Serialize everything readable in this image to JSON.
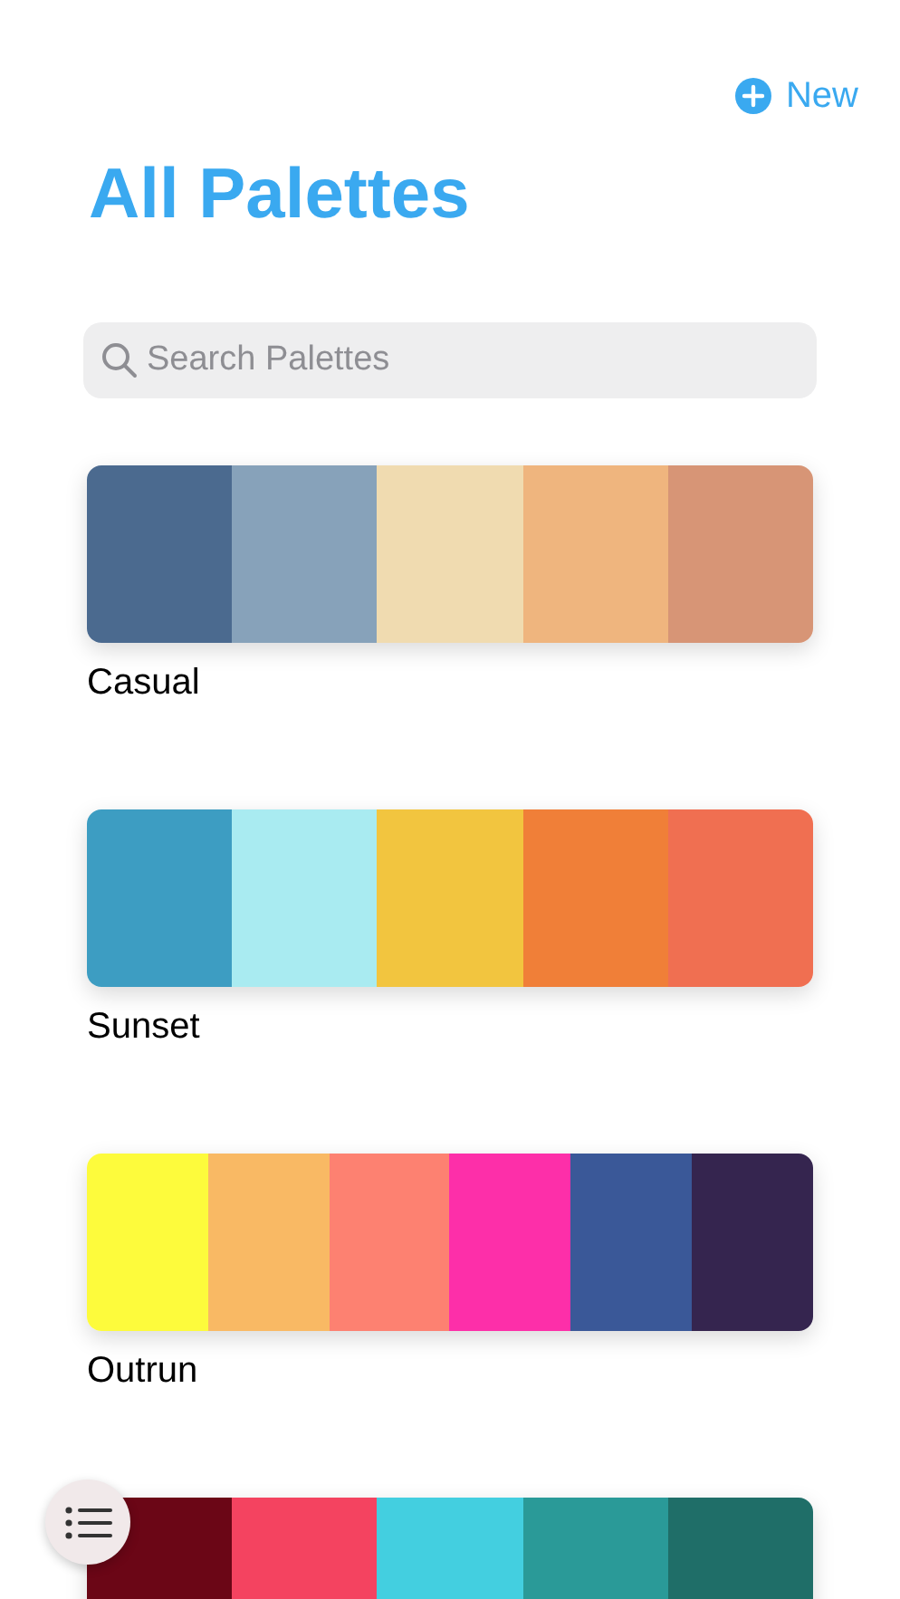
{
  "new_button": {
    "label": "New"
  },
  "title": "All Palettes",
  "search": {
    "placeholder": "Search Palettes"
  },
  "palettes": [
    {
      "name": "Casual",
      "swatches": [
        {
          "color": "#4b6a8f"
        },
        {
          "color": "#87a2ba"
        },
        {
          "color": "#f0dbb0"
        },
        {
          "color": "#efb57e"
        },
        {
          "color": "#d79576"
        }
      ]
    },
    {
      "name": "Sunset",
      "swatches": [
        {
          "color": "#3d9dc2"
        },
        {
          "color": "#a9ebf1"
        },
        {
          "color": "#f2c53f"
        },
        {
          "color": "#f07f38"
        },
        {
          "color": "#f06f51"
        }
      ]
    },
    {
      "name": "Outrun",
      "swatches": [
        {
          "color": "#fdfb3c"
        },
        {
          "color": "#f9b964"
        },
        {
          "color": "#fd8171"
        },
        {
          "color": "#fd2fa9"
        },
        {
          "color": "#3a5898"
        },
        {
          "color": "#35254f"
        }
      ]
    },
    {
      "swatches": [
        {
          "color": "#6b0616"
        },
        {
          "color": "#f44360"
        },
        {
          "color": "#43cfe0"
        },
        {
          "color": "#2a9a98"
        },
        {
          "color": "#1f6e68"
        }
      ]
    }
  ]
}
